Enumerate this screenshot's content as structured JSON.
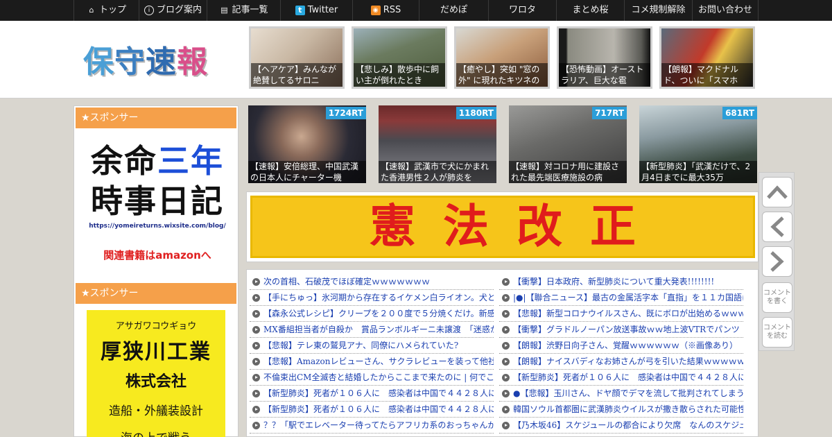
{
  "nav": {
    "items": [
      {
        "label": "トップ",
        "icon": "home-icon"
      },
      {
        "label": "ブログ案内",
        "icon": "info-icon"
      },
      {
        "label": "記事一覧",
        "icon": "list-icon"
      },
      {
        "label": "Twitter",
        "icon": "twitter-icon"
      },
      {
        "label": "RSS",
        "icon": "rss-icon"
      },
      {
        "label": "だめぽ",
        "icon": ""
      },
      {
        "label": "ワロタ",
        "icon": ""
      },
      {
        "label": "まとめ桜",
        "icon": ""
      },
      {
        "label": "コメ規制解除",
        "icon": ""
      },
      {
        "label": "お問い合わせ",
        "icon": ""
      }
    ]
  },
  "header": {
    "logo": {
      "c1": "保",
      "c2": "守",
      "c3": "速",
      "c4": "報"
    },
    "thumbs": [
      {
        "caption": "【ヘアケア】みんなが絶賛してるサロニ"
      },
      {
        "caption": "【悲しみ】散歩中に飼い主が倒れたとき"
      },
      {
        "caption": "【癒やし】突如 \"窓の外\" に現れたキツネの"
      },
      {
        "caption": "【恐怖動画】オーストラリア、巨大な雹"
      },
      {
        "caption": "【朗報】マクドナルド、ついに「スマホ"
      }
    ]
  },
  "sidebar": {
    "sponsor1": "★スポンサー",
    "sponsor2": "★スポンサー",
    "ad1": {
      "line1a": "余命",
      "line1b": "三年",
      "line2": "時事日記",
      "url": "https://yomeireturns.wixsite.com/blog/",
      "amazon": "関連書籍はamazonへ"
    },
    "ad2": {
      "kana": "アサガワコウギョウ",
      "company": "厚狭川工業",
      "kk": "株式会社",
      "service": "造船・外艤装設計",
      "more": "海の上で戦う"
    }
  },
  "ranking": [
    {
      "rt": "1724RT",
      "caption": "【速報】安倍総理、中国武漢の日本人にチャーター機"
    },
    {
      "rt": "1180RT",
      "caption": "【速報】武漢市で犬にかまれた香港男性２人が肺炎を"
    },
    {
      "rt": "717RT",
      "caption": "【速報】対コロナ用に建設された最先端医療施設の病"
    },
    {
      "rt": "681RT",
      "caption": "【新型肺炎】「武漢だけで、2月4日までに最大35万"
    }
  ],
  "banner": {
    "text": "憲法改正"
  },
  "links": {
    "left": [
      "次の首相、石破茂でほぼ確定ｗｗｗｗｗｗｗ",
      "【手にちゅっ】氷河期から存在するイケメン白ライオン。犬と",
      "【森永公式レシピ】クリープを２００度で５分焼くだけ。新感",
      "MX番組担当者が自殺か　賞品ランボルギーニ未譲渡　「迷惑か",
      "【悲報】テレ東の鷲見アナ、同僚にハメられていた?",
      "【悲報】Amazonレビューさん、サクラレビューを装って他社を",
      "不倫束出CM全滅杏と結婚したからここまで来たのに | 何でここ",
      "【新型肺炎】死者が１０６人に　感染者は中国で４４２８人に",
      "【新型肺炎】死者が１０６人に　感染者は中国で４４２８人に",
      "？？「駅でエレベーター待ってたらアフリカ系のおっちゃんが"
    ],
    "right": [
      "【衝撃】日本政府、新型肺炎について重大発表!!!!!!!!",
      "|●|【聯合ニュース】最古の金属活字本「直指」を１１カ国語に",
      "【悲報】新型コロナウイルスさん、既にボロが出始めるｗｗｗ",
      "【衝撃】グラドルノーパン放送事故ｗｗ地上波VTRでパンツ",
      "【朗報】渋野日向子さん、覚醒ｗｗｗｗｗｗ（※画像あり）",
      "【朗報】ナイスバディなお姉さんが弓を引いた結果ｗｗｗｗｗ",
      "【新型肺炎】死者が１０６人に　感染者は中国で４４２８人に",
      "●【悲報】玉川さん、ドヤ顔でデマを流して批判されてしまう な",
      "韓国ソウル首都圏に武漢肺炎ウイルスが撒き散らされた可能性",
      "【乃木坂46】スケジュールの都合により欠席　なんのスケジュ"
    ]
  },
  "floatbar": {
    "write": "コメントを書く",
    "read": "コメントを読む"
  }
}
